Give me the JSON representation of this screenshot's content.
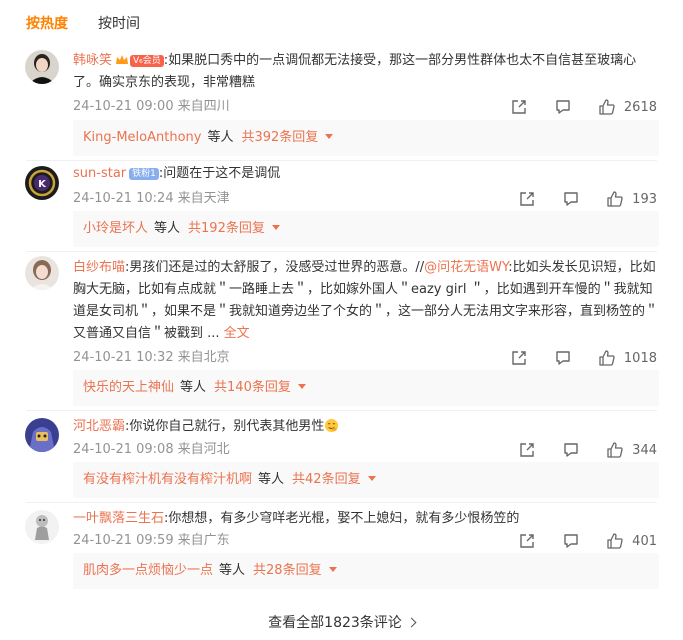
{
  "tabs": [
    {
      "label": "按热度"
    },
    {
      "label": "按时间"
    }
  ],
  "comments": [
    {
      "user": "韩咏笑",
      "vip_badge": "V₆会员",
      "text": ":如果脱口秀中的一点调侃都无法接受，那这一部分男性群体也太不自信甚至玻璃心了。确实京东的表现，非常糟糕",
      "time": "24-10-21 09:00",
      "location": "来自四川",
      "likes": "2618",
      "reply_user": "King-MeloAnthony",
      "reply_suffix": "等人",
      "reply_count": "共392条回复"
    },
    {
      "user": "sun-star",
      "fan_badge": "铁粉1",
      "text": ":问题在于这不是调侃",
      "time": "24-10-21 10:24",
      "location": "来自天津",
      "likes": "193",
      "reply_user": "小玲是坏人",
      "reply_suffix": "等人",
      "reply_count": "共192条回复"
    },
    {
      "user": "白纱布喵",
      "text_a": ":男孩们还是过的太舒服了，没感受过世界的恶意。//",
      "mention": "@问花无语WY",
      "text_b": ":比如头发长见识短，比如胸大无脑，比如有点成就＂一路睡上去＂，比如嫁外国人＂eazy girl ＂，比如遇到开车慢的＂我就知道是女司机＂，如果不是＂我就知道旁边坐了个女的＂，这一部分人无法用文字来形容，直到杨笠的＂又普通又自信＂被戳到 ...",
      "full_text": "全文",
      "time": "24-10-21 10:32",
      "location": "来自北京",
      "likes": "1018",
      "reply_user": "快乐的天上神仙",
      "reply_suffix": "等人",
      "reply_count": "共140条回复"
    },
    {
      "user": "河北恶霸",
      "text": ":你说你自己就行，别代表其他男性",
      "time": "24-10-21 09:08",
      "location": "来自河北",
      "likes": "344",
      "reply_user": "有没有榨汁机有没有榨汁机啊",
      "reply_suffix": "等人",
      "reply_count": "共42条回复"
    },
    {
      "user": "一叶飘落三生石",
      "text": ":你想想，有多少穹咩老光棍，娶不上媳妇，就有多少恨杨笠的",
      "time": "24-10-21 09:59",
      "location": "来自广东",
      "likes": "401",
      "reply_user": "肌肉多一点烦恼少一点",
      "reply_suffix": "等人",
      "reply_count": "共28条回复"
    }
  ],
  "footer": {
    "view_all": "查看全部1823条评论"
  },
  "colors": {
    "accent": "#ff8200",
    "link": "#eb7350",
    "meta": "#939393"
  },
  "icons": [
    "share-icon",
    "comment-icon",
    "like-icon",
    "chevron-right-icon",
    "caret-down-icon",
    "crown-icon",
    "emoji-icon"
  ]
}
